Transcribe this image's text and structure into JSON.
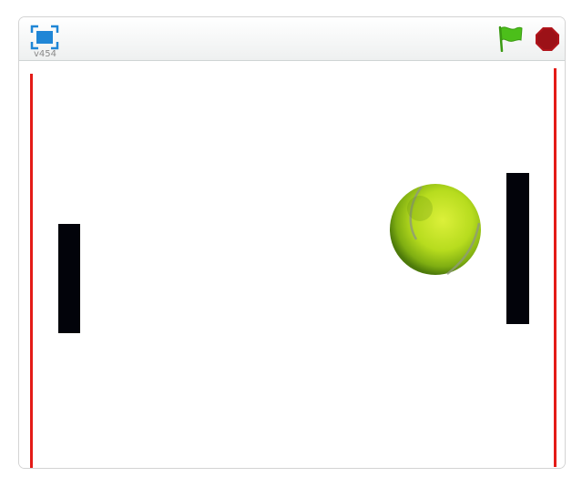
{
  "toolbar": {
    "version": "v454",
    "fullscreen_icon": "fullscreen-icon",
    "flag_icon": "green-flag-icon",
    "stop_icon": "stop-sign-icon"
  },
  "colors": {
    "wall": "#e41b17",
    "paddle": "#02030a",
    "flag": "#4cbf1a",
    "stop": "#b0141b",
    "fullscreen": "#1f86d6"
  },
  "stage": {
    "sprites": [
      "left-wall",
      "right-wall",
      "left-paddle",
      "right-paddle",
      "tennis-ball"
    ]
  }
}
